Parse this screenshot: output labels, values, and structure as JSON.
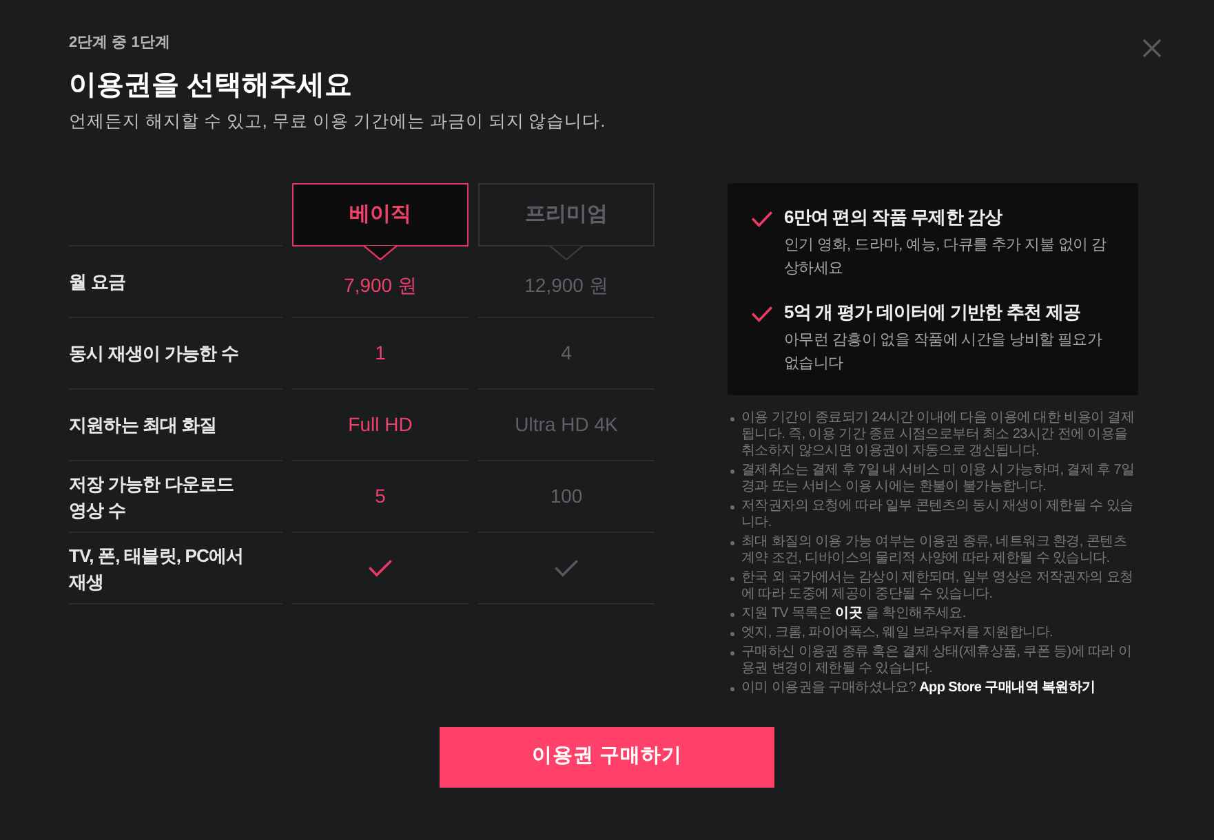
{
  "step": "2단계 중 1단계",
  "title": "이용권을 선택해주세요",
  "subtitle": "언제든지 해지할 수 있고, 무료 이용 기간에는 과금이 되지 않습니다.",
  "plans": [
    {
      "name": "베이직",
      "selected": true
    },
    {
      "name": "프리미엄",
      "selected": false
    }
  ],
  "features": [
    {
      "kind": "text",
      "label": "월 요금",
      "values": [
        "7,900 원",
        "12,900 원"
      ]
    },
    {
      "kind": "text",
      "label": "동시 재생이 가능한 수",
      "values": [
        "1",
        "4"
      ]
    },
    {
      "kind": "text",
      "label": "지원하는 최대 화질",
      "values": [
        "Full HD",
        "Ultra HD 4K"
      ]
    },
    {
      "kind": "text",
      "label": "저장 가능한 다운로드 영상 수",
      "values": [
        "5",
        "100"
      ]
    },
    {
      "kind": "check",
      "label": "TV, 폰, 태블릿, PC에서 재생",
      "included": [
        true,
        true
      ]
    }
  ],
  "benefits": [
    {
      "title": "6만여 편의 작품 무제한 감상",
      "description": "인기 영화, 드라마, 예능, 다큐를 추가 지불 없이 감상하세요"
    },
    {
      "title": "5억 개 평가 데이터에 기반한 추천 제공",
      "description": "아무런 감흥이 없을 작품에 시간을 낭비할 필요가 없습니다"
    }
  ],
  "notes": [
    {
      "kind": "plain",
      "text": "이용 기간이 종료되기 24시간 이내에 다음 이용에 대한 비용이 결제됩니다. 즉, 이용 기간 종료 시점으로부터 최소 23시간 전에 이용을 취소하지 않으시면 이용권이 자동으로 갱신됩니다."
    },
    {
      "kind": "plain",
      "text": "결제취소는 결제 후 7일 내 서비스 미 이용 시 가능하며, 결제 후 7일 경과 또는 서비스 이용 시에는 환불이 불가능합니다."
    },
    {
      "kind": "plain",
      "text": "저작권자의 요청에 따라 일부 콘텐츠의 동시 재생이 제한될 수 있습니다."
    },
    {
      "kind": "plain",
      "text": "최대 화질의 이용 가능 여부는 이용권 종류, 네트워크 환경, 콘텐츠 계약 조건, 디바이스의 물리적 사양에 따라 제한될 수 있습니다."
    },
    {
      "kind": "plain",
      "text": "한국 외 국가에서는 감상이 제한되며, 일부 영상은 저작권자의 요청에 따라 도중에 제공이 중단될 수 있습니다."
    },
    {
      "kind": "link",
      "text": "지원 TV 목록은 ",
      "link": "이곳",
      "text_after": " 을 확인해주세요."
    },
    {
      "kind": "plain",
      "text": "엣지, 크롬, 파이어폭스, 웨일 브라우저를 지원합니다."
    },
    {
      "kind": "plain",
      "text": "구매하신 이용권 종류 혹은 결제 상태(제휴상품, 쿠폰 등)에 따라 이용권 변경이 제한될 수 있습니다."
    },
    {
      "kind": "link",
      "text": "이미 이용권을 구매하셨나요? ",
      "link": "App Store 구매내역 복원하기"
    }
  ],
  "purchase_button": "이용권 구매하기"
}
